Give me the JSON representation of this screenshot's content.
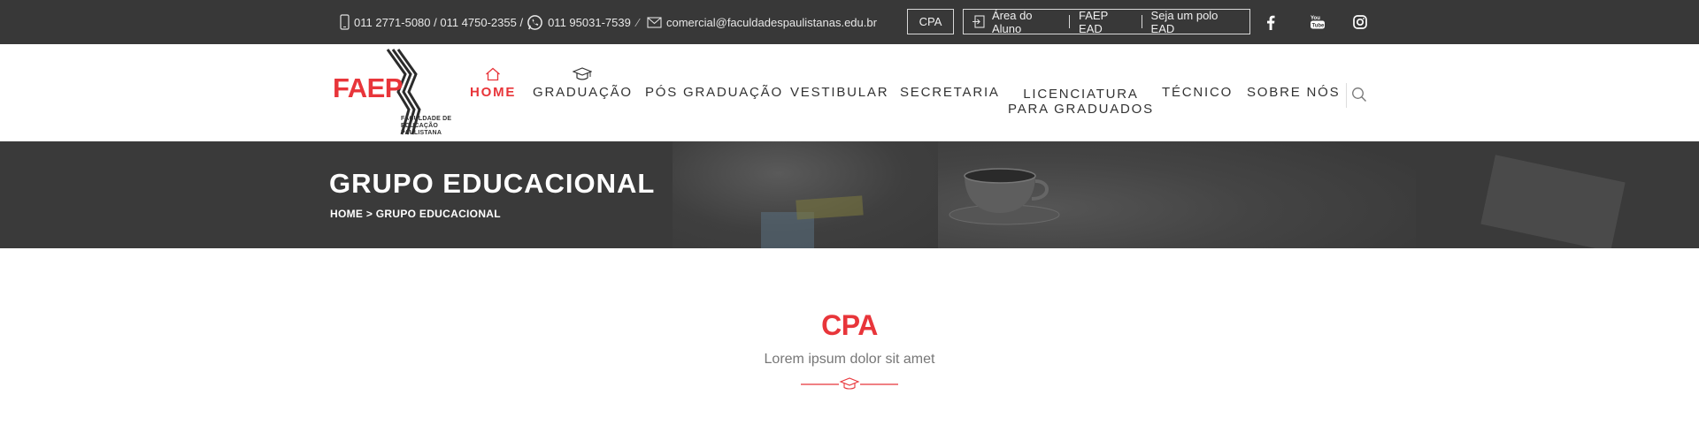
{
  "topbar": {
    "phones": "011 2771-5080 / 011 4750-2355 /",
    "whatsapp": "011 95031-7539",
    "separator": "⁄",
    "email": "comercial@faculdadespaulistanas.edu.br",
    "cpa_button": "CPA",
    "links": [
      "Área do Aluno",
      "FAEP EAD",
      "Seja um polo EAD"
    ],
    "social": [
      "facebook-icon",
      "youtube-icon",
      "instagram-icon"
    ]
  },
  "logo": {
    "name": "FAEP",
    "subtitle_lines": [
      "FACULDADE DE",
      "EDUCAÇÃO",
      "PAULISTANA"
    ]
  },
  "menu": {
    "items": [
      {
        "label": "HOME",
        "active": true,
        "icon": "home-icon"
      },
      {
        "label": "GRADUAÇÃO",
        "active": false,
        "icon": "graduation-cap-icon"
      },
      {
        "label": "PÓS GRADUAÇÃO",
        "active": false
      },
      {
        "label": "VESTIBULAR",
        "active": false
      },
      {
        "label": "SECRETARIA",
        "active": false
      },
      {
        "label_line1": "LICENCIATURA",
        "label_line2": "PARA GRADUADOS",
        "active": false
      },
      {
        "label": "TÉCNICO",
        "active": false
      },
      {
        "label": "SOBRE NÓS",
        "active": false
      }
    ]
  },
  "hero": {
    "title": "GRUPO EDUCACIONAL",
    "breadcrumb": "HOME > GRUPO EDUCACIONAL"
  },
  "section": {
    "title": "CPA",
    "subtitle": "Lorem ipsum dolor sit amet"
  },
  "colors": {
    "accent": "#e8353a",
    "topbar_bg": "#383838",
    "hero_bg": "#3a3a3a"
  }
}
